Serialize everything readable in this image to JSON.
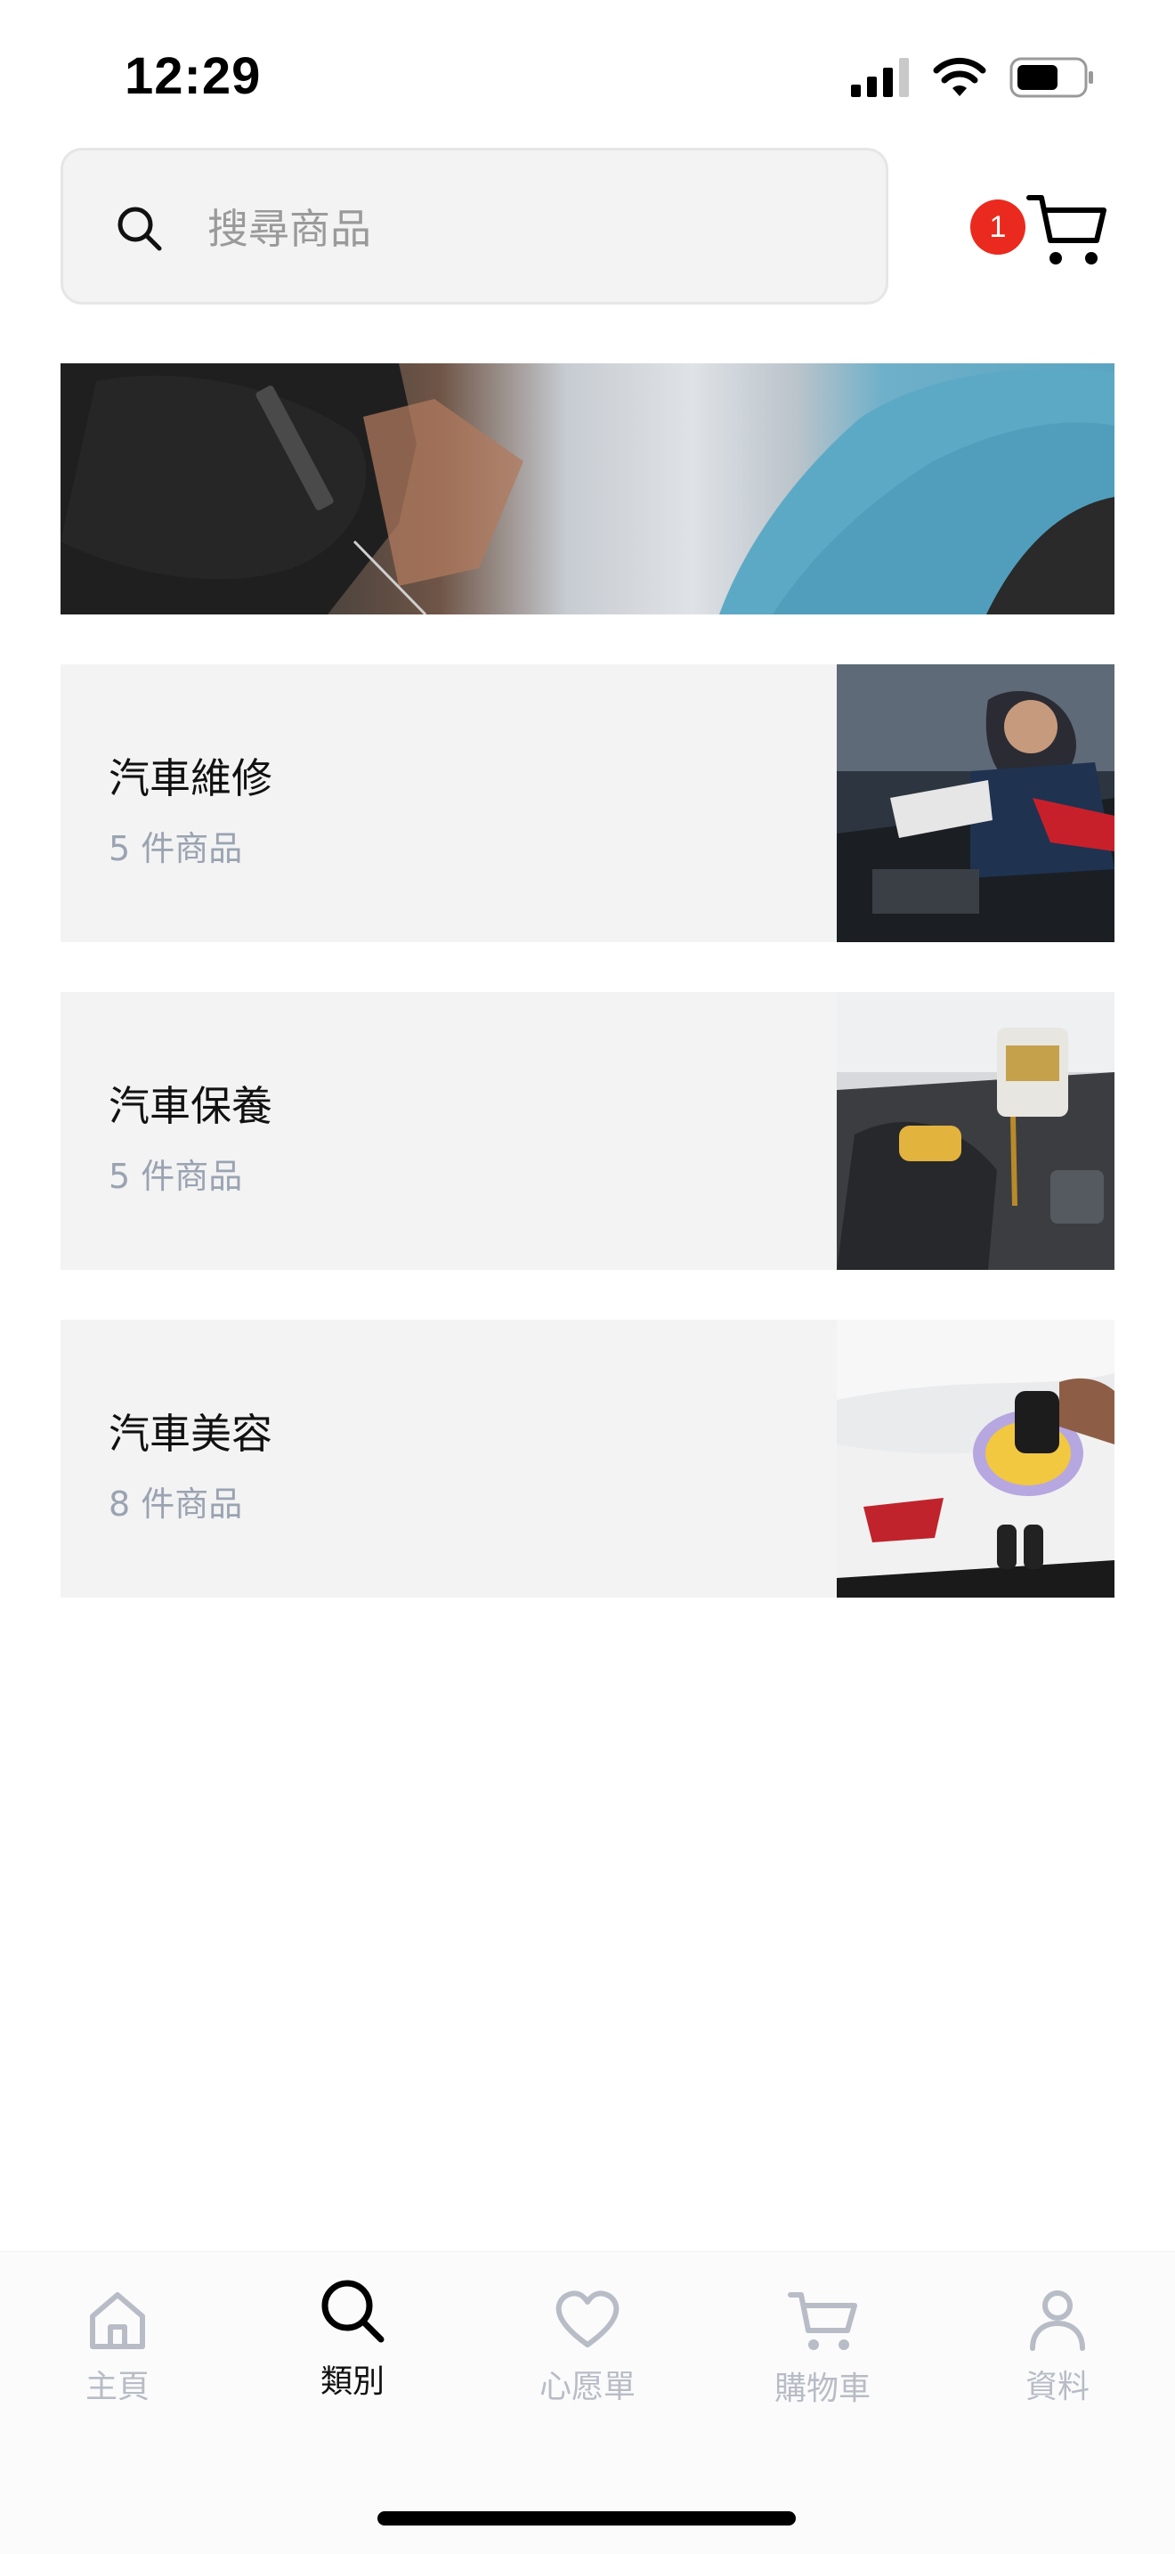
{
  "status_bar": {
    "time": "12:29"
  },
  "search": {
    "placeholder": "搜尋商品"
  },
  "cart": {
    "badge_count": "1"
  },
  "categories": [
    {
      "title": "汽車維修",
      "count": "5 件商品",
      "image": "mechanic-repair-photo"
    },
    {
      "title": "汽車保養",
      "count": "5 件商品",
      "image": "engine-oil-photo"
    },
    {
      "title": "汽車美容",
      "count": "8 件商品",
      "image": "car-polishing-photo"
    }
  ],
  "banner": {
    "image": "detailing-banner-photo"
  },
  "nav": {
    "items": [
      {
        "label": "主頁",
        "icon": "home-icon",
        "active": false
      },
      {
        "label": "類別",
        "icon": "search-icon",
        "active": true
      },
      {
        "label": "心愿單",
        "icon": "heart-icon",
        "active": false
      },
      {
        "label": "購物車",
        "icon": "cart-icon",
        "active": false
      },
      {
        "label": "資料",
        "icon": "user-icon",
        "active": false
      }
    ]
  },
  "colors": {
    "badge": "#ea2a1e",
    "muted_text": "#9aa3b2",
    "card_bg": "#f3f3f3",
    "nav_inactive": "#b7bcc6"
  }
}
